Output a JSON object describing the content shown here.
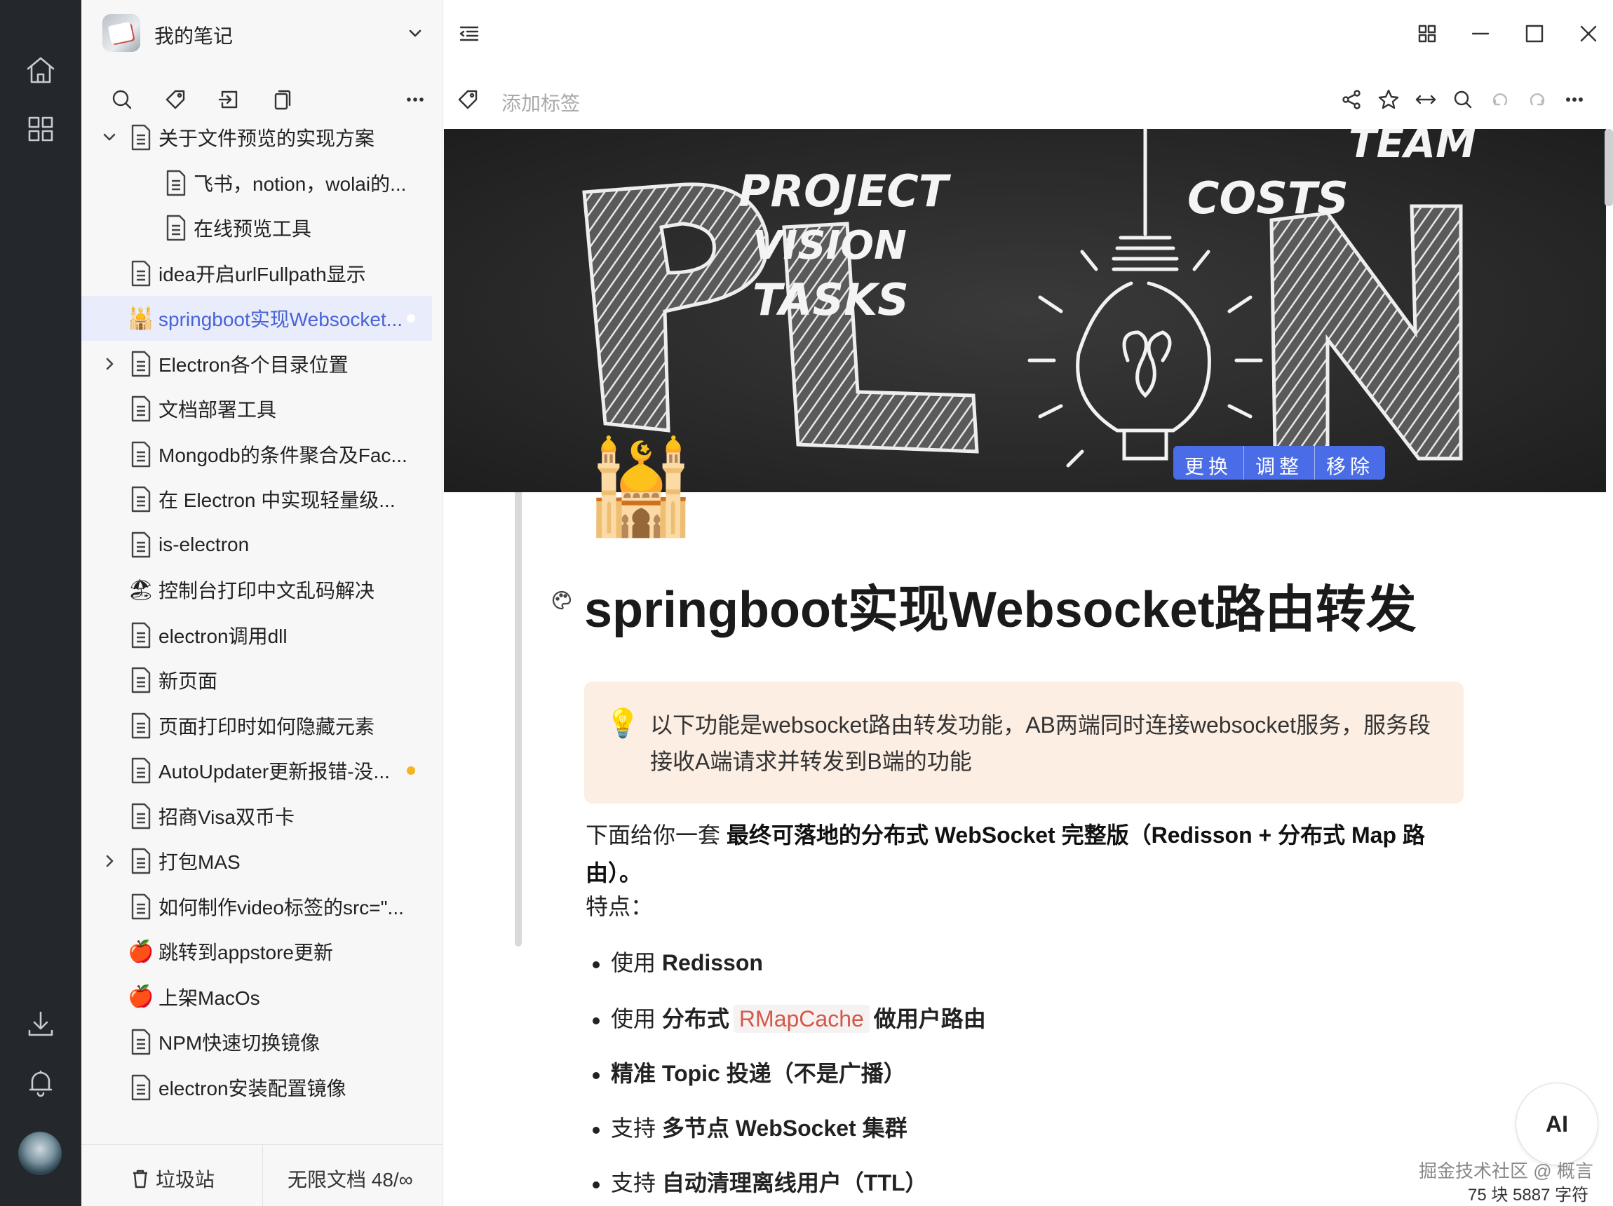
{
  "notebook": {
    "title": "我的笔记"
  },
  "tree": [
    {
      "label": "关于文件预览的实现方案",
      "indent": 0,
      "expanded": true,
      "icon": "doc"
    },
    {
      "label": "飞书，notion，wolai的...",
      "indent": 1,
      "icon": "doc"
    },
    {
      "label": "在线预览工具",
      "indent": 1,
      "icon": "doc"
    },
    {
      "label": "idea开启urlFullpath显示",
      "indent": 0,
      "icon": "doc"
    },
    {
      "label": "springboot实现Websocket...",
      "indent": 0,
      "icon": "mosque",
      "active": true
    },
    {
      "label": "Electron各个目录位置",
      "indent": 0,
      "collapsed": true,
      "icon": "doc"
    },
    {
      "label": "文档部署工具",
      "indent": 0,
      "icon": "doc"
    },
    {
      "label": "Mongodb的条件聚合及Fac...",
      "indent": 0,
      "icon": "doc"
    },
    {
      "label": "在 Electron 中实现轻量级...",
      "indent": 0,
      "icon": "doc"
    },
    {
      "label": "is-electron",
      "indent": 0,
      "icon": "doc"
    },
    {
      "label": "控制台打印中文乱码解决",
      "indent": 0,
      "icon": "beach"
    },
    {
      "label": "electron调用dll",
      "indent": 0,
      "icon": "doc"
    },
    {
      "label": "新页面",
      "indent": 0,
      "icon": "doc"
    },
    {
      "label": "页面打印时如何隐藏元素",
      "indent": 0,
      "icon": "doc"
    },
    {
      "label": "AutoUpdater更新报错-没...",
      "indent": 0,
      "icon": "doc",
      "dot": true
    },
    {
      "label": "招商Visa双币卡",
      "indent": 0,
      "icon": "doc"
    },
    {
      "label": "打包MAS",
      "indent": 0,
      "collapsed": true,
      "icon": "doc"
    },
    {
      "label": "如何制作video标签的src=\"...",
      "indent": 0,
      "icon": "doc"
    },
    {
      "label": "跳转到appstore更新",
      "indent": 0,
      "icon": "apple"
    },
    {
      "label": "上架MacOs",
      "indent": 0,
      "icon": "apple"
    },
    {
      "label": "NPM快速切换镜像",
      "indent": 0,
      "icon": "doc"
    },
    {
      "label": "electron安装配置镜像",
      "indent": 0,
      "icon": "doc"
    }
  ],
  "footer": {
    "trash": "垃圾站",
    "quota": "无限文档 48/∞"
  },
  "tags": {
    "placeholder": "添加标签"
  },
  "cover": {
    "buttons": [
      "更换",
      "调整",
      "移除"
    ],
    "chalk_words": [
      "PROJECT",
      "VISION",
      "TASKS",
      "COSTS",
      "TEAM"
    ]
  },
  "page": {
    "icon": "🕌",
    "title": "springboot实现Websocket路由转发",
    "callout": {
      "icon": "💡",
      "text": "以下功能是websocket路由转发功能，AB两端同时连接websocket服务，服务段接收A端请求并转发到B端的功能"
    },
    "intro_prefix": "下面给你一套 ",
    "intro_bold": "最终可落地的分布式 WebSocket 完整版（Redisson + 分布式 Map 路由）。",
    "features_label": "特点：",
    "bullets": [
      {
        "pre": "使用 ",
        "bold": "Redisson"
      },
      {
        "pre": "使用 ",
        "bold": "分布式",
        "code": "RMapCache",
        "post": "做用户路由"
      },
      {
        "pre": "",
        "bold": "精准 Topic 投递（不是广播）"
      },
      {
        "pre": "支持 ",
        "bold": "多节点 WebSocket 集群"
      },
      {
        "pre": "支持 ",
        "bold": "自动清理离线用户（TTL）"
      }
    ]
  },
  "ai": {
    "label": "AI"
  },
  "watermark": "掘金技术社区 @ 概言",
  "stats": "75 块  5887 字符"
}
